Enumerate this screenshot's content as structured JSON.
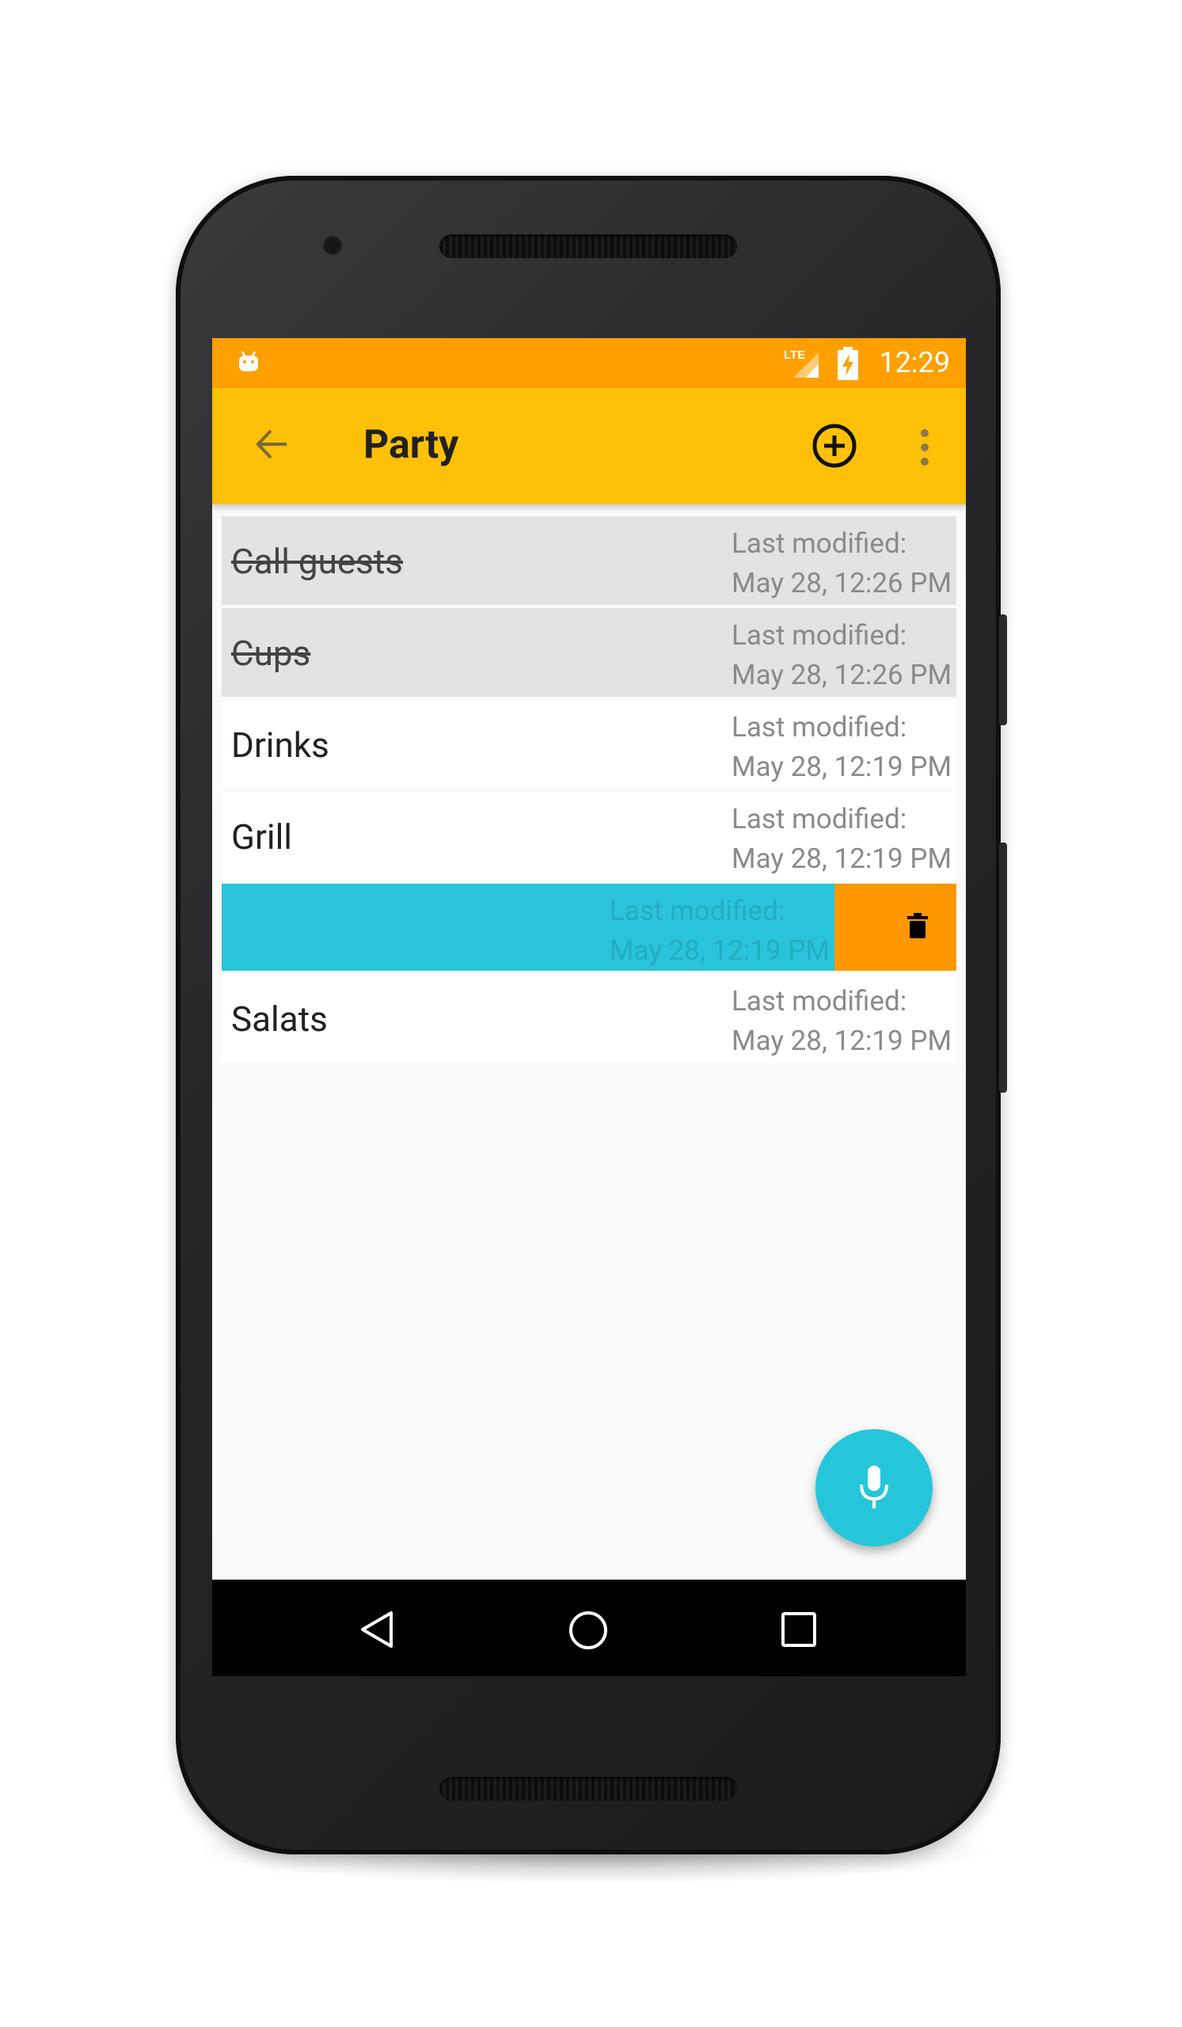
{
  "status_bar": {
    "time": "12:29",
    "network": "LTE",
    "icons": [
      "android-notification-icon",
      "lte-signal-icon",
      "battery-charging-icon"
    ]
  },
  "toolbar": {
    "title": "Party",
    "icons": [
      "back-arrow-icon",
      "add-circle-icon",
      "more-vert-icon"
    ]
  },
  "list": {
    "items": [
      {
        "title": "Call guests",
        "done": true,
        "meta_label": "Last modified:",
        "meta_date": "May 28, 12:26 PM"
      },
      {
        "title": "Cups",
        "done": true,
        "meta_label": "Last modified:",
        "meta_date": "May 28, 12:26 PM"
      },
      {
        "title": "Drinks",
        "done": false,
        "meta_label": "Last modified:",
        "meta_date": "May 28, 12:19 PM"
      },
      {
        "title": "Grill",
        "done": false,
        "meta_label": "Last modified:",
        "meta_date": "May 28, 12:19 PM"
      },
      {
        "title": "",
        "done": false,
        "swiped": true,
        "meta_label": "Last modified:",
        "meta_date": "May 28, 12:19 PM"
      },
      {
        "title": "Salats",
        "done": false,
        "meta_label": "Last modified:",
        "meta_date": "May 28, 12:19 PM"
      }
    ]
  },
  "fab": {
    "icon": "microphone-icon"
  },
  "nav_bar": {
    "icons": [
      "nav-back-icon",
      "nav-home-icon",
      "nav-recents-icon"
    ]
  },
  "colors": {
    "status_bar": "#ffa000",
    "toolbar": "#ffc107",
    "swipe_background": "#29c4db",
    "delete_background": "#ff9800",
    "fab": "#26c6da"
  }
}
